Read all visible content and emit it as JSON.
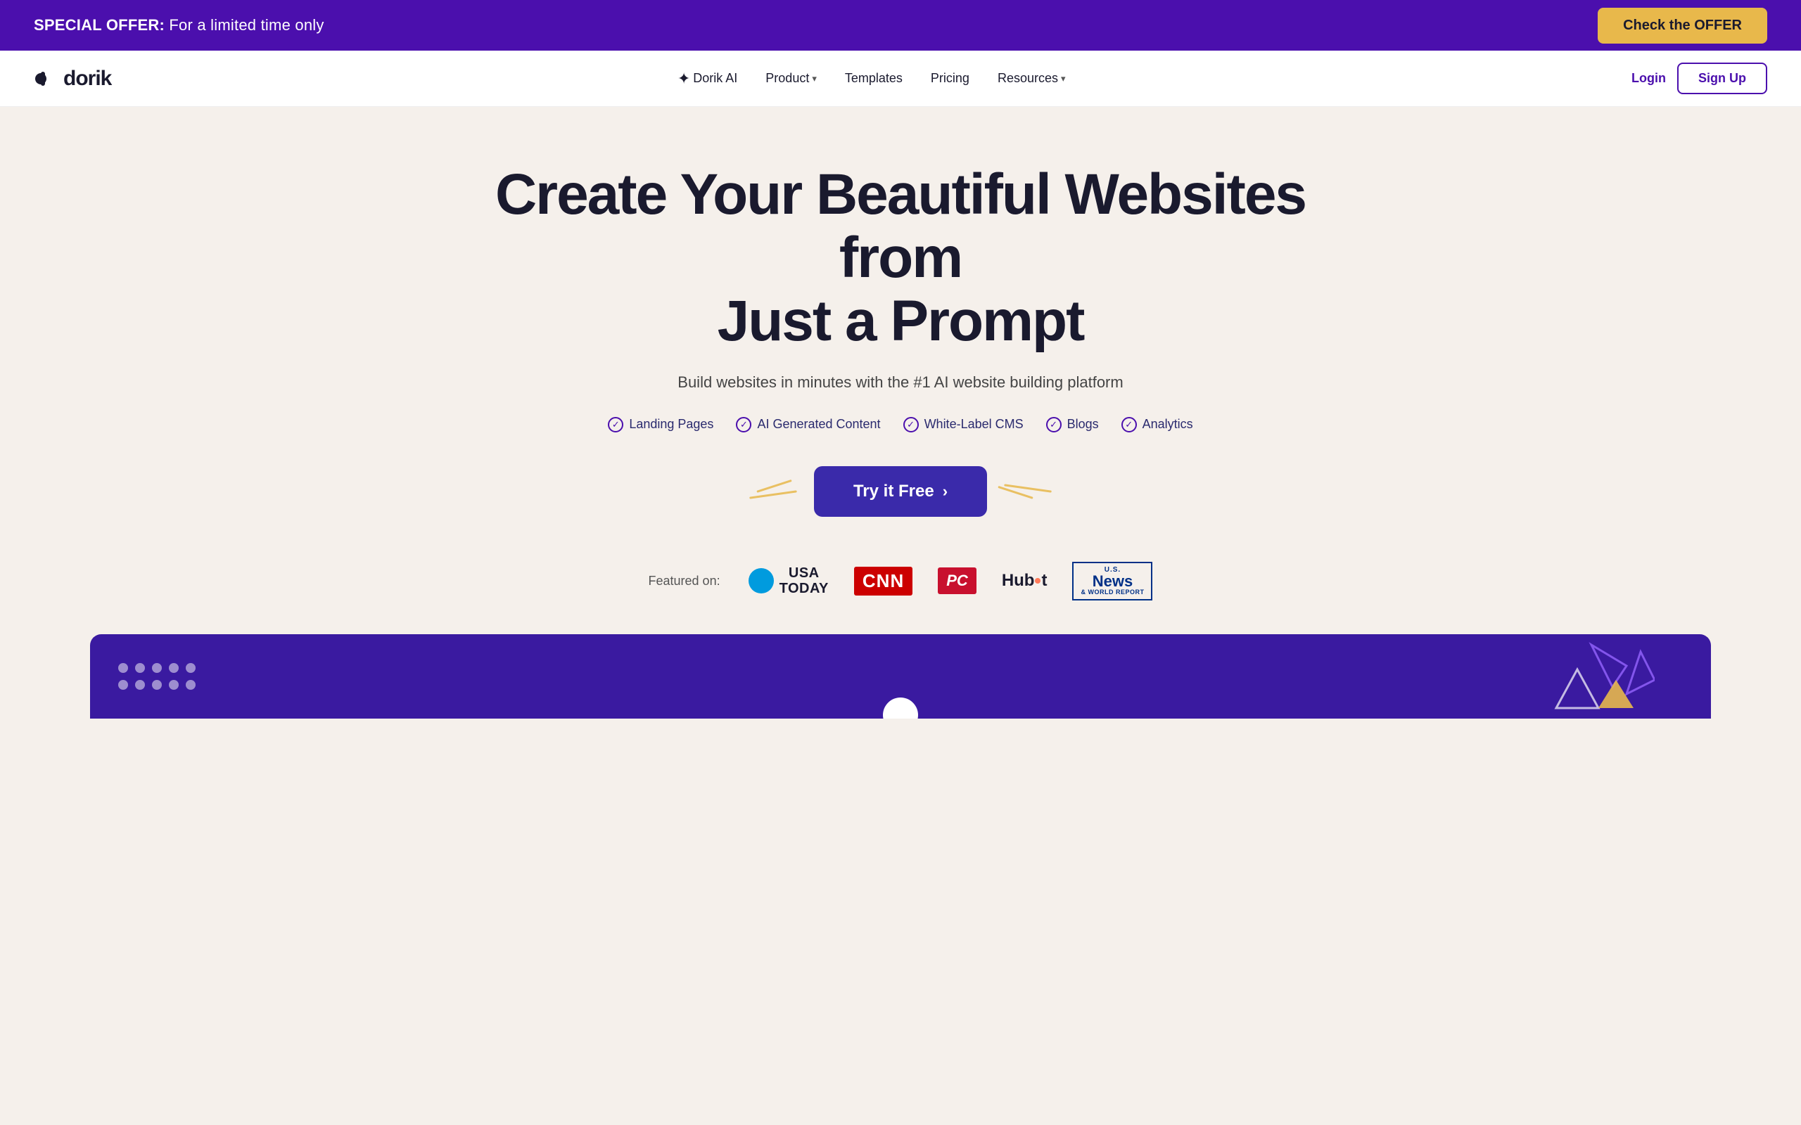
{
  "banner": {
    "special_label": "SPECIAL OFFER:",
    "special_text": " For a limited time only",
    "cta_label": "Check the OFFER"
  },
  "nav": {
    "logo": "dorik",
    "links": [
      {
        "id": "dorik-ai",
        "label": "Dorik AI",
        "has_icon": true,
        "has_dropdown": false
      },
      {
        "id": "product",
        "label": "Product",
        "has_dropdown": true
      },
      {
        "id": "templates",
        "label": "Templates",
        "has_dropdown": false
      },
      {
        "id": "pricing",
        "label": "Pricing",
        "has_dropdown": false
      },
      {
        "id": "resources",
        "label": "Resources",
        "has_dropdown": true
      }
    ],
    "login_label": "Login",
    "signup_label": "Sign Up"
  },
  "hero": {
    "headline_line1": "Create Your Beautiful Websites from",
    "headline_line2": "Just a Prompt",
    "subheadline": "Build websites in minutes with the #1 AI website building platform",
    "features": [
      "Landing Pages",
      "AI Generated Content",
      "White-Label CMS",
      "Blogs",
      "Analytics"
    ],
    "cta_label": "Try it Free",
    "cta_arrow": "›"
  },
  "featured": {
    "label": "Featured on:",
    "logos": [
      {
        "id": "usa-today",
        "name": "USA TODAY"
      },
      {
        "id": "cnn",
        "name": "CNN"
      },
      {
        "id": "pc-mag",
        "name": "PC"
      },
      {
        "id": "hubspot",
        "name": "HubSpot"
      },
      {
        "id": "us-news",
        "name": "U.S.News"
      }
    ]
  },
  "colors": {
    "purple": "#4b0fad",
    "dark_purple": "#3a1aa0",
    "banner_bg": "#4b0fad",
    "gold": "#e8b84b",
    "hero_bg": "#f5f0eb"
  }
}
